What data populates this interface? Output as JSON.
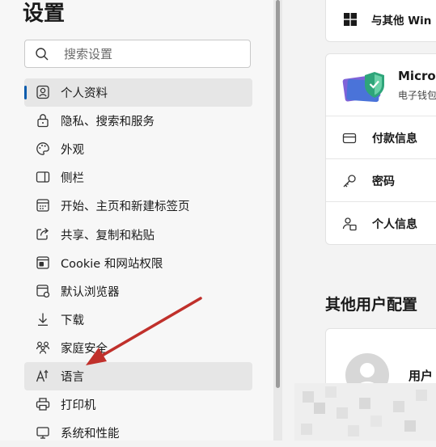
{
  "sidebar": {
    "title": "设置",
    "search": {
      "placeholder": "搜索设置",
      "value": ""
    },
    "items": [
      {
        "label": "个人资料",
        "icon": "profile-icon",
        "active": true
      },
      {
        "label": "隐私、搜索和服务",
        "icon": "lock-icon"
      },
      {
        "label": "外观",
        "icon": "palette-icon"
      },
      {
        "label": "侧栏",
        "icon": "sidebar-icon"
      },
      {
        "label": "开始、主页和新建标签页",
        "icon": "home-page-icon"
      },
      {
        "label": "共享、复制和粘贴",
        "icon": "share-icon"
      },
      {
        "label": "Cookie 和网站权限",
        "icon": "cookie-icon"
      },
      {
        "label": "默认浏览器",
        "icon": "browser-icon"
      },
      {
        "label": "下载",
        "icon": "download-icon"
      },
      {
        "label": "家庭安全",
        "icon": "family-icon"
      },
      {
        "label": "语言",
        "icon": "language-icon",
        "hover": true
      },
      {
        "label": "打印机",
        "icon": "printer-icon"
      },
      {
        "label": "系统和性能",
        "icon": "system-icon"
      }
    ]
  },
  "main": {
    "sync_card": {
      "label": "与其他 Win",
      "icon": "windows-icon"
    },
    "wallet_card": {
      "title": "Micros",
      "subtitle": "电子钱包",
      "rows": [
        {
          "label": "付款信息",
          "icon": "card-icon"
        },
        {
          "label": "密码",
          "icon": "key-icon"
        },
        {
          "label": "个人信息",
          "icon": "person-info-icon"
        }
      ]
    },
    "section_title": "其他用户配置",
    "profile_card": {
      "label": "用户"
    }
  },
  "colors": {
    "accent": "#0a5cad",
    "arrow": "#c0302b"
  }
}
